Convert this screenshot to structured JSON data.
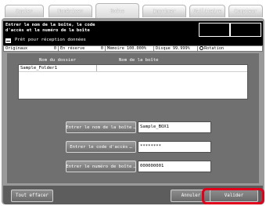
{
  "tabs": [
    {
      "label": "Copier",
      "active": false
    },
    {
      "label": "Numériser",
      "active": false
    },
    {
      "label": "Boîte",
      "active": true
    },
    {
      "label": "Imprimer",
      "active": false
    },
    {
      "label": "Utilitaire",
      "active": false
    },
    {
      "label": "Compteur",
      "active": false
    }
  ],
  "header": {
    "message_line1": "Entrer le nom de la boîte, le code",
    "message_line2": "d'accès et le numéro de la boîte",
    "status": "Prêt pour réception données",
    "status_icon": "printer-icon"
  },
  "statusbar": {
    "originals_label": "Originaux",
    "originals_value": "0",
    "reserve_label": "En réserve",
    "reserve_value": "0",
    "memory": "Mémoire 100.000%",
    "disk": "Disque 99.999%",
    "rotation_label": "Rotation",
    "rotation_icon": "rotation-icon"
  },
  "list": {
    "col_folder": "Nom du dossier",
    "col_box": "Nom de la boîte",
    "rows": [
      {
        "folder": "Sample_Folder1",
        "box": ""
      }
    ]
  },
  "form": {
    "box_name_label": "Entrer le nom de la boîte",
    "box_name_value": "Sample_BOX1",
    "access_code_label": "Entrer le code d'accès",
    "access_code_value": "********",
    "box_number_label": "Entrer le numéro de boîte",
    "box_number_value": "000000001"
  },
  "footer": {
    "clear_label": "Tout effacer",
    "cancel_label": "Annuler",
    "ok_label": "Valider"
  },
  "colors": {
    "highlight": "#e0001b",
    "header_bg": "#000000",
    "panel_bg": "#707070"
  }
}
